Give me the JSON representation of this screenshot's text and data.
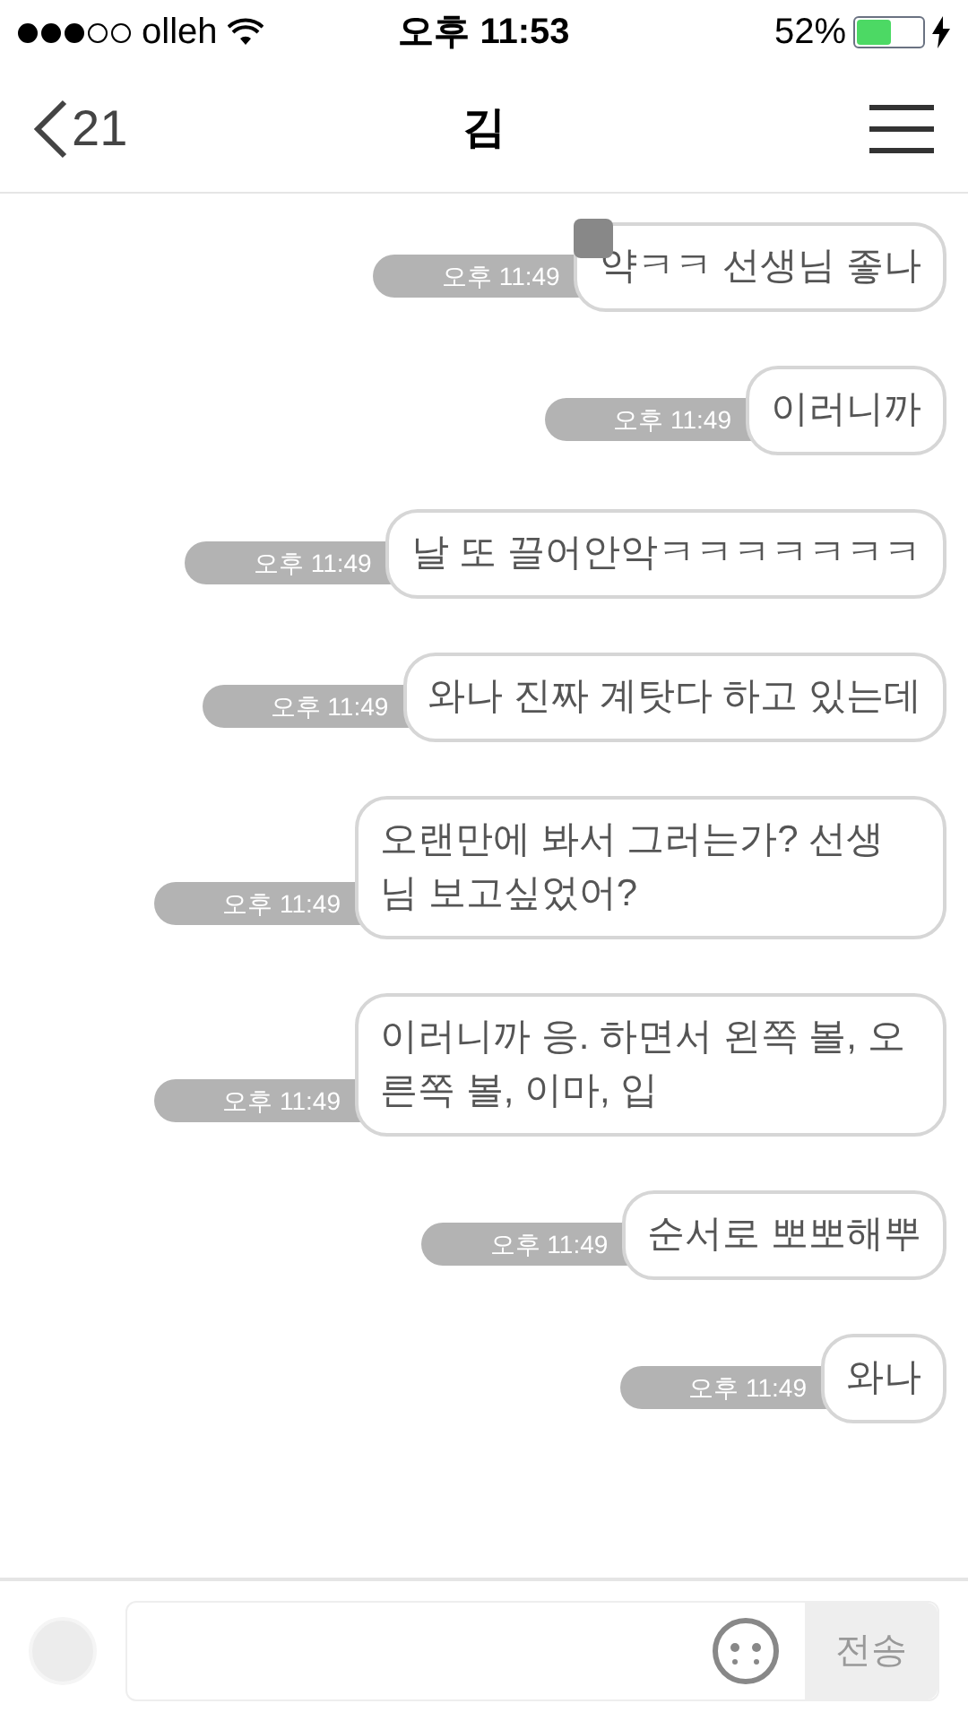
{
  "status_bar": {
    "carrier": "olleh",
    "time": "오후 11:53",
    "battery": "52%"
  },
  "nav": {
    "back_count": "21",
    "title": "김"
  },
  "messages": [
    {
      "text": "약ㅋㅋ 선생님 좋나",
      "time": "오후 11:49",
      "redacted": true
    },
    {
      "text": "이러니까",
      "time": "오후 11:49",
      "redacted": false
    },
    {
      "text": "날 또 끌어안악ㅋㅋㅋㅋㅋㅋㅋ",
      "time": "오후 11:49",
      "redacted": false
    },
    {
      "text": "와나 진짜 계탓다 하고 있는데",
      "time": "오후 11:49",
      "redacted": false
    },
    {
      "text": "오랜만에 봐서 그러는가? 선생님 보고싶었어?",
      "time": "오후 11:49",
      "redacted": false
    },
    {
      "text": "이러니까 응. 하면서 왼쪽 볼, 오른쪽 볼, 이마, 입",
      "time": "오후 11:49",
      "redacted": false
    },
    {
      "text": "순서로 뽀뽀해뿌",
      "time": "오후 11:49",
      "redacted": false
    },
    {
      "text": "와나",
      "time": "오후 11:49",
      "redacted": false
    }
  ],
  "composer": {
    "send": "전송"
  }
}
